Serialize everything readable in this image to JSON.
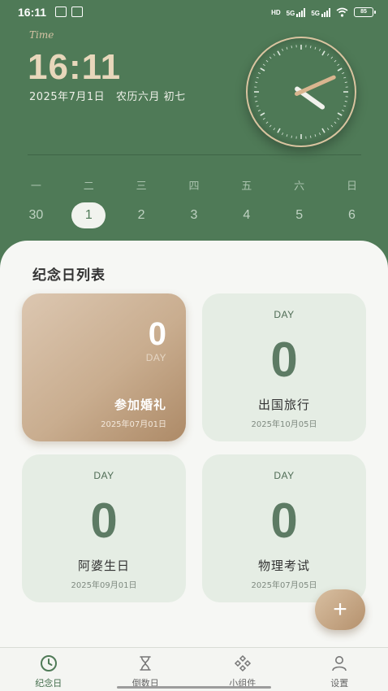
{
  "status_bar": {
    "time": "16:11",
    "network_1": "5G",
    "network_2": "5G",
    "hd_badge": "HD",
    "battery": "85"
  },
  "header": {
    "time_word": "Time",
    "time": "16:11",
    "date": "2025年7月1日",
    "lunar": "农历六月 初七"
  },
  "calendar": {
    "weekdays": [
      "一",
      "二",
      "三",
      "四",
      "五",
      "六",
      "日"
    ],
    "days": [
      "30",
      "1",
      "2",
      "3",
      "4",
      "5",
      "6"
    ],
    "selected_day": "1"
  },
  "main": {
    "section_title": "纪念日列表",
    "cards": [
      {
        "day_label": "DAY",
        "count": "0",
        "title": "参加婚礼",
        "date": "2025年07月01日",
        "featured": true
      },
      {
        "day_label": "DAY",
        "count": "0",
        "title": "出国旅行",
        "date": "2025年10月05日",
        "featured": false
      },
      {
        "day_label": "DAY",
        "count": "0",
        "title": "阿婆生日",
        "date": "2025年09月01日",
        "featured": false
      },
      {
        "day_label": "DAY",
        "count": "0",
        "title": "物理考试",
        "date": "2025年07月05日",
        "featured": false
      }
    ],
    "fab_label": "+"
  },
  "tabbar": {
    "items": [
      {
        "label": "纪念日",
        "icon": "clock-icon",
        "active": true
      },
      {
        "label": "倒数日",
        "icon": "hourglass-icon",
        "active": false
      },
      {
        "label": "小组件",
        "icon": "widgets-icon",
        "active": false
      },
      {
        "label": "设置",
        "icon": "person-icon",
        "active": false
      }
    ]
  },
  "colors": {
    "primary_green": "#4f7a57",
    "accent_tan": "#c9ad8f",
    "card_green": "#e5ede4"
  }
}
